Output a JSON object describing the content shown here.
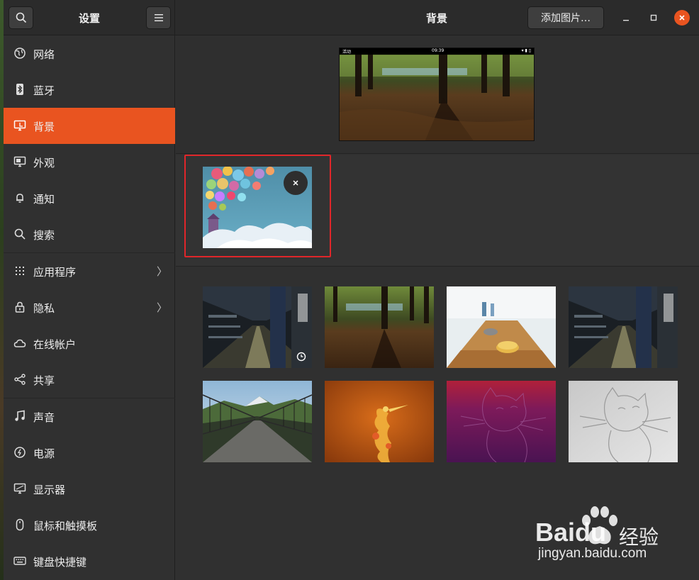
{
  "sidebar_header": {
    "title": "设置",
    "search_icon": "search-icon",
    "menu_icon": "hamburger-menu-icon"
  },
  "main_header": {
    "title": "背景",
    "add_button": "添加图片…"
  },
  "window_controls": {
    "minimize": "minimize-icon",
    "maximize": "maximize-icon",
    "close": "close-icon"
  },
  "sidebar": {
    "items": [
      {
        "label": "网络",
        "icon": "network-icon"
      },
      {
        "label": "蓝牙",
        "icon": "bluetooth-icon"
      },
      {
        "label": "背景",
        "icon": "background-icon",
        "active": true
      },
      {
        "label": "外观",
        "icon": "appearance-icon"
      },
      {
        "label": "通知",
        "icon": "bell-icon"
      },
      {
        "label": "搜索",
        "icon": "search-icon"
      },
      {
        "label": "应用程序",
        "icon": "apps-grid-icon",
        "chevron": true
      },
      {
        "label": "隐私",
        "icon": "lock-icon",
        "chevron": true
      },
      {
        "label": "在线帐户",
        "icon": "cloud-icon"
      },
      {
        "label": "共享",
        "icon": "share-icon"
      },
      {
        "label": "声音",
        "icon": "music-note-icon"
      },
      {
        "label": "电源",
        "icon": "power-icon"
      },
      {
        "label": "显示器",
        "icon": "display-icon"
      },
      {
        "label": "鼠标和触摸板",
        "icon": "mouse-icon"
      },
      {
        "label": "键盘快捷键",
        "icon": "keyboard-icon"
      }
    ]
  },
  "preview": {
    "topbar_left": "活动",
    "topbar_clock": "09:39"
  },
  "custom_wallpapers": [
    {
      "image": "hot-air-balloons",
      "remove_icon": "close-icon"
    }
  ],
  "wallpapers": [
    {
      "image": "subway-station",
      "selected": false,
      "badge_icon": "clock-icon"
    },
    {
      "image": "forest-shadows"
    },
    {
      "image": "shuffleboard-table"
    },
    {
      "image": "subway-station-2"
    },
    {
      "image": "suspension-bridge"
    },
    {
      "image": "orange-crane-art"
    },
    {
      "image": "purple-fossa"
    },
    {
      "image": "grey-fossa"
    }
  ],
  "watermark": {
    "brand": "Bai",
    "brand2": "du",
    "brand_cn": "经验",
    "url": "jingyan.baidu.com"
  },
  "colors": {
    "accent": "#e95420",
    "highlight_border": "#e0262a",
    "bg": "#303030"
  }
}
